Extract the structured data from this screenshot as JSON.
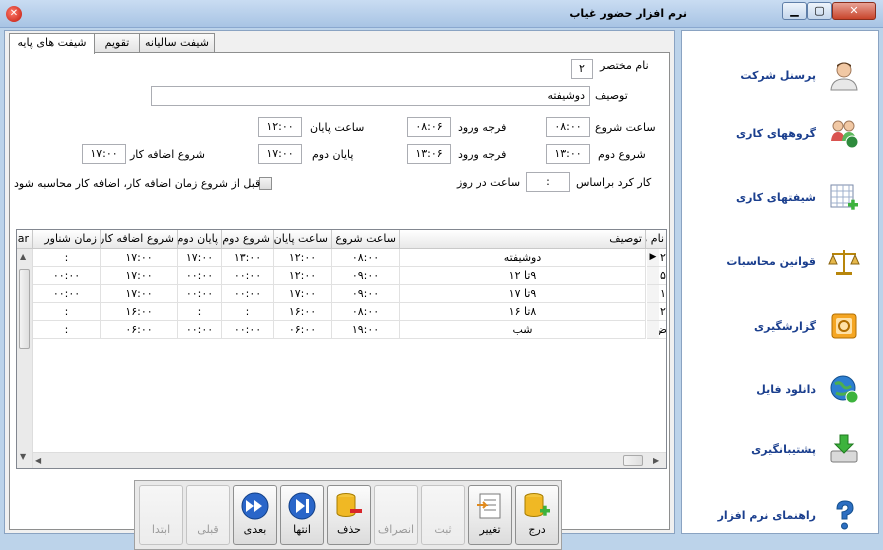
{
  "window": {
    "title": "نرم افزار حضور غیاب"
  },
  "tabs": [
    {
      "label": "شیفت های پایه",
      "active": true
    },
    {
      "label": "تقویم",
      "active": false
    },
    {
      "label": "شیفت سالیانه",
      "active": false
    }
  ],
  "form": {
    "short_name_label": "نام مختصر",
    "short_name_value": "۲",
    "description_label": "توصیف",
    "description_value": "دوشیفته",
    "start_time_label": "ساعت شروع",
    "start_time_value": "۰۸:۰۰",
    "entry_grace_label": "فرجه ورود",
    "entry_grace_value": "۰۸:۰۶",
    "end_time_label": "ساعت پایان",
    "end_time_value": "۱۲:۰۰",
    "second_start_label": "شروع دوم",
    "second_start_value": "۱۳:۰۰",
    "entry_grace2_label": "فرجه ورود",
    "entry_grace2_value": "۱۳:۰۶",
    "second_end_label": "پایان دوم",
    "second_end_value": "۱۷:۰۰",
    "overtime_start_label": "شروع اضافه کار",
    "overtime_start_value": "۱۷:۰۰",
    "workday_basis_label": "کار کرد براساس",
    "workday_basis_value": ":",
    "hours_per_day_label": "ساعت در روز",
    "overtime_checkbox_label": "قبل از شروع زمان اضافه کار، اضافه کار محاسبه شود"
  },
  "grid": {
    "columns": [
      "نام مختصر",
      "توصیف",
      "ساعت شروع",
      "ساعت پایان",
      "شروع دوم",
      "پایان دوم",
      "شروع اضافه کار",
      "زمان شناور",
      "ar"
    ],
    "rows": [
      [
        "۲",
        "دوشیفته",
        "۰۸:۰۰",
        "۱۲:۰۰",
        "۱۳:۰۰",
        "۱۷:۰۰",
        "۱۷:۰۰",
        ":"
      ],
      [
        "۵",
        "۹تا ۱۲",
        "۰۹:۰۰",
        "۱۲:۰۰",
        "۰۰:۰۰",
        "۰۰:۰۰",
        "۱۷:۰۰",
        "۰۰:۰۰"
      ],
      [
        "۱",
        "۹تا ۱۷",
        "۰۹:۰۰",
        "۱۷:۰۰",
        "۰۰:۰۰",
        "۰۰:۰۰",
        "۱۷:۰۰",
        "۰۰:۰۰"
      ],
      [
        "۲",
        "۸تا ۱۶",
        "۰۸:۰۰",
        "۱۶:۰۰",
        ":",
        ":",
        "۱۶:۰۰",
        ":"
      ],
      [
        "ض",
        "شب",
        "۱۹:۰۰",
        "۰۶:۰۰",
        "۰۰:۰۰",
        "۰۰:۰۰",
        "۰۶:۰۰",
        ":"
      ]
    ],
    "selected_row": 0
  },
  "toolbar": {
    "insert": "درج",
    "edit": "تغییر",
    "save": "ثبت",
    "cancel": "انصراف",
    "delete": "حذف",
    "last": "انتها",
    "next": "بعدی",
    "previous": "قبلی",
    "first": "ابتدا"
  },
  "sidebar": {
    "items": [
      {
        "label": "پرسنل شرکت",
        "icon": "person-icon"
      },
      {
        "label": "گروههای کاری",
        "icon": "group-icon"
      },
      {
        "label": "شیفتهای کاری",
        "icon": "calendar-add-icon"
      },
      {
        "label": "قوانین محاسبات",
        "icon": "scales-icon"
      },
      {
        "label": "گزارشگیری",
        "icon": "report-icon"
      },
      {
        "label": "دانلود فایل",
        "icon": "globe-download-icon"
      },
      {
        "label": "پشتیبانگیری",
        "icon": "backup-icon"
      },
      {
        "label": "راهنمای نرم افزار",
        "icon": "help-icon"
      }
    ]
  }
}
